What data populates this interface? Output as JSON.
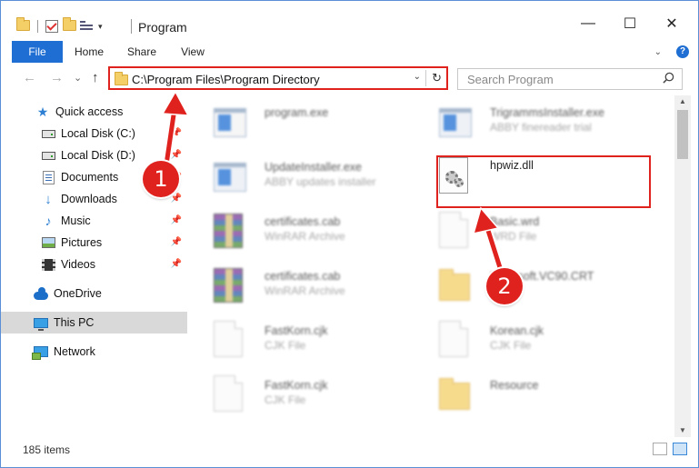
{
  "window": {
    "title": "Program",
    "controls": {
      "minimize": "—",
      "maximize": "☐",
      "close": "✕"
    }
  },
  "ribbon": {
    "tabs": [
      "File",
      "Home",
      "Share",
      "View"
    ],
    "active_tab": "File",
    "help_label": "?"
  },
  "navigation": {
    "address_path": "C:\\Program Files\\Program Directory",
    "search_placeholder": "Search Program",
    "back_label": "←",
    "forward_label": "→",
    "recent_label": "⌄",
    "up_label": "↑",
    "refresh_label": "↻"
  },
  "sidebar": {
    "items": [
      {
        "label": "Quick access",
        "icon": "star-icon"
      },
      {
        "label": "Local Disk (C:)",
        "icon": "drive-icon",
        "pinned": true
      },
      {
        "label": "Local Disk (D:)",
        "icon": "drive-icon",
        "pinned": true
      },
      {
        "label": "Documents",
        "icon": "documents-icon",
        "pinned": true
      },
      {
        "label": "Downloads",
        "icon": "download-icon",
        "pinned": true
      },
      {
        "label": "Music",
        "icon": "music-icon",
        "pinned": true
      },
      {
        "label": "Pictures",
        "icon": "pictures-icon",
        "pinned": true
      },
      {
        "label": "Videos",
        "icon": "videos-icon",
        "pinned": true
      },
      {
        "label": "OneDrive",
        "icon": "cloud-icon"
      },
      {
        "label": "This PC",
        "icon": "computer-icon",
        "selected": true
      },
      {
        "label": "Network",
        "icon": "network-icon"
      }
    ]
  },
  "files": [
    {
      "name": "program.exe",
      "type": "",
      "icon": "exe-icon"
    },
    {
      "name": "TrigrammsInstaller.exe",
      "type": "ABBY finereader trial",
      "icon": "exe-icon"
    },
    {
      "name": "UpdateInstaller.exe",
      "type": "ABBY updates installer",
      "icon": "exe-icon"
    },
    {
      "name": "hpwiz.dll",
      "type": "",
      "icon": "dll-gear-icon",
      "highlighted": true
    },
    {
      "name": "certificates.cab",
      "type": "WinRAR Archive",
      "icon": "archive-icon"
    },
    {
      "name": "Basic.wrd",
      "type": "WRD File",
      "icon": "document-icon"
    },
    {
      "name": "certificates.cab",
      "type": "WinRAR Archive",
      "icon": "archive-icon"
    },
    {
      "name": "Microsoft.VC90.CRT",
      "type": "",
      "icon": "folder-icon"
    },
    {
      "name": "FastKorn.cjk",
      "type": "CJK File",
      "icon": "document-icon"
    },
    {
      "name": "Korean.cjk",
      "type": "CJK File",
      "icon": "document-icon"
    },
    {
      "name": "FastKorn.cjk",
      "type": "CJK File",
      "icon": "document-icon"
    },
    {
      "name": "Resource",
      "type": "",
      "icon": "folder-icon"
    }
  ],
  "status": {
    "item_count": "185 items"
  },
  "annotations": {
    "step1": "1",
    "step2": "2",
    "color": "#e0221f"
  }
}
